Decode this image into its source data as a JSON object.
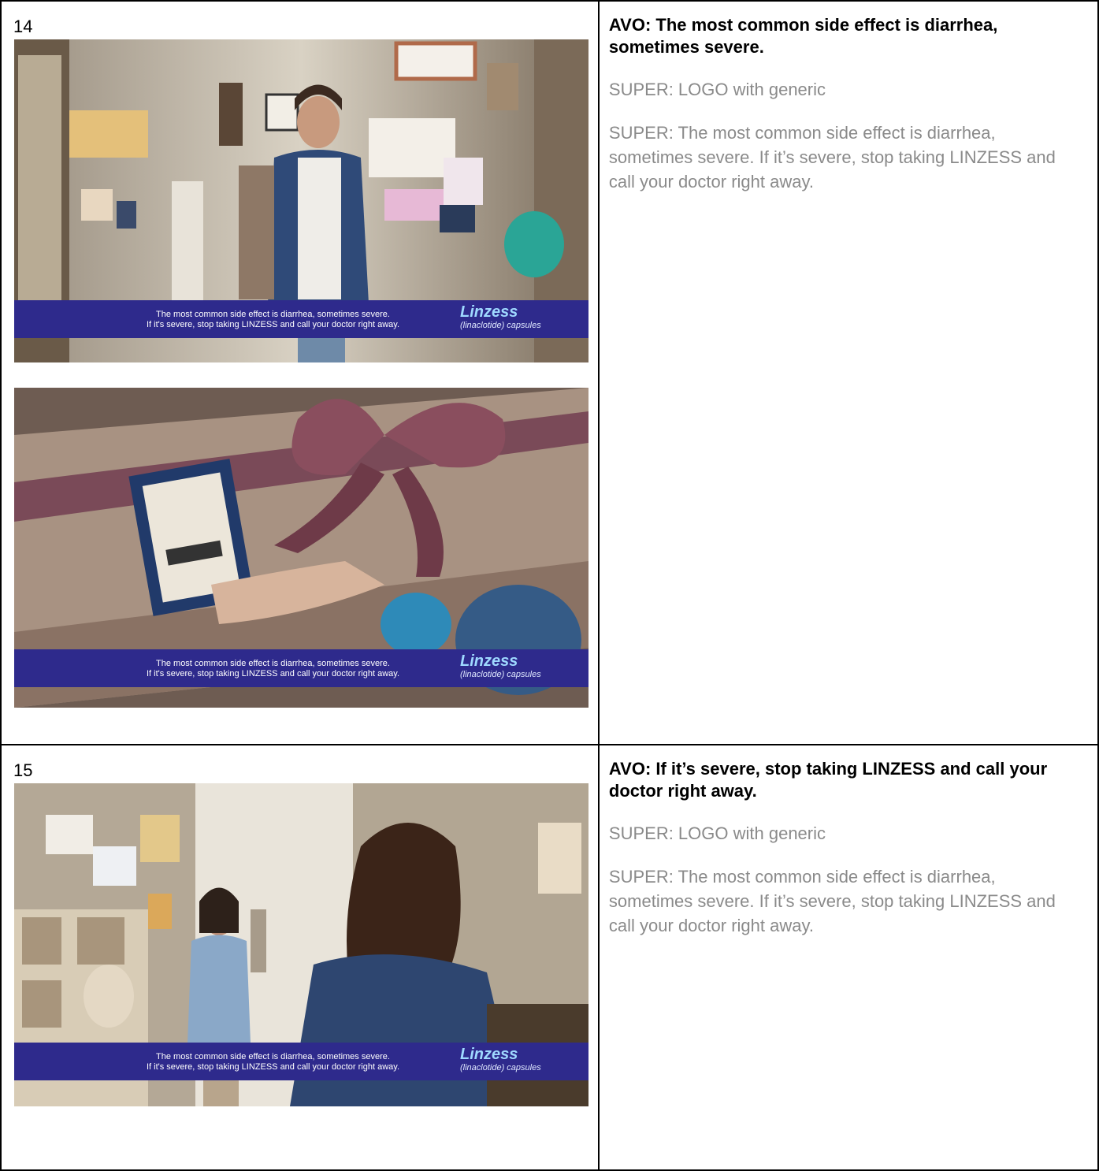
{
  "board": {
    "shots": [
      {
        "number": "14",
        "frames": [
          {
            "description_icon": "girl-with-backpack-in-bedroom-image",
            "super_line1": "The most common side effect is diarrhea, sometimes severe.",
            "super_line2": "If it's severe, stop taking LINZESS and call your doctor right away.",
            "logo_name": "Linzess",
            "logo_generic": "(linaclotide) capsules"
          },
          {
            "description_icon": "gift-box-with-ribbon-image",
            "super_line1": "The most common side effect is diarrhea, sometimes severe.",
            "super_line2": "If it's severe, stop taking LINZESS and call your doctor right away.",
            "logo_name": "Linzess",
            "logo_generic": "(linaclotide) capsules"
          }
        ],
        "avo": "AVO: The most common side effect is diarrhea, sometimes severe.",
        "super_logo": "SUPER: LOGO with generic",
        "super_text": "SUPER: The most common side effect is diarrhea, sometimes severe. If it’s severe, stop taking LINZESS and call your doctor right away."
      },
      {
        "number": "15",
        "frames": [
          {
            "description_icon": "mother-in-doorway-girl-foreground-image",
            "super_line1": "The most common side effect is diarrhea, sometimes severe.",
            "super_line2": "If it's severe, stop taking LINZESS and call your doctor right away.",
            "logo_name": "Linzess",
            "logo_generic": "(linaclotide) capsules"
          }
        ],
        "avo": "AVO: If it’s severe, stop taking LINZESS and call your doctor right away.",
        "super_logo": "SUPER: LOGO with generic",
        "super_text": "SUPER: The most common side effect is diarrhea, sometimes severe. If it’s severe, stop taking LINZESS and call your doctor right away."
      }
    ],
    "colors": {
      "super_bar": "#2e2a8c",
      "logo_name": "#9fd9ff",
      "super_text": "#8a8a8a"
    }
  }
}
